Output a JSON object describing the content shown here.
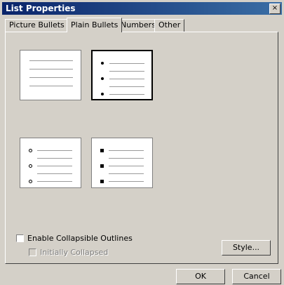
{
  "window": {
    "title": "List Properties",
    "close_glyph": "×"
  },
  "tabs": [
    {
      "label": "Picture Bullets",
      "active": false
    },
    {
      "label": "Plain Bullets",
      "active": true
    },
    {
      "label": "Numbers",
      "active": false
    },
    {
      "label": "Other",
      "active": false
    }
  ],
  "bullet_styles": [
    {
      "style": "none",
      "selected": false
    },
    {
      "style": "disc",
      "selected": true
    },
    {
      "style": "circle",
      "selected": false
    },
    {
      "style": "square",
      "selected": false
    }
  ],
  "options": {
    "enable_collapsible_outlines": {
      "label": "Enable Collapsible Outlines",
      "checked": false
    },
    "initially_collapsed": {
      "label": "Initially Collapsed",
      "checked": false,
      "disabled": true
    }
  },
  "buttons": {
    "style": "Style...",
    "ok": "OK",
    "cancel": "Cancel"
  }
}
